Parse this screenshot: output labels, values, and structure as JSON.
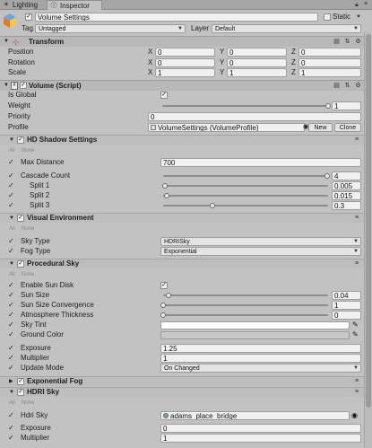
{
  "tabs": [
    {
      "label": "Lighting"
    },
    {
      "label": "Inspector"
    }
  ],
  "object": {
    "active": "✓",
    "name": "Volume Settings",
    "static_label": "Static",
    "tag_label": "Tag",
    "tag_value": "Untagged",
    "layer_label": "Layer",
    "layer_value": "Default"
  },
  "transform": {
    "title": "Transform",
    "position": {
      "label": "Position",
      "x": "0",
      "y": "0",
      "z": "0"
    },
    "rotation": {
      "label": "Rotation",
      "x": "0",
      "y": "0",
      "z": "0"
    },
    "scale": {
      "label": "Scale",
      "x": "1",
      "y": "1",
      "z": "1"
    }
  },
  "volume": {
    "title": "Volume (Script)",
    "is_global_label": "Is Global",
    "is_global": true,
    "weight_label": "Weight",
    "weight_value": "1",
    "weight_fraction": 1.0,
    "priority_label": "Priority",
    "priority_value": "0",
    "profile_label": "Profile",
    "profile_value": "VolumeSettings (VolumeProfile)",
    "new_label": "New",
    "clone_label": "Clone"
  },
  "hd_shadow": {
    "title": "HD Shadow Settings",
    "all": "All",
    "none": "None",
    "max_distance_label": "Max Distance",
    "max_distance": "700",
    "cascade_count_label": "Cascade Count",
    "cascade_count": "4",
    "cascade_count_fraction": 1.0,
    "split1_label": "Split 1",
    "split1": "0.005",
    "split1_fraction": 0.005,
    "split2_label": "Split 2",
    "split2": "0.015",
    "split2_fraction": 0.015,
    "split3_label": "Split 3",
    "split3": "0.3",
    "split3_fraction": 0.3
  },
  "visual_env": {
    "title": "Visual Environment",
    "all": "All",
    "none": "None",
    "sky_type_label": "Sky Type",
    "sky_type": "HDRISky",
    "fog_type_label": "Fog Type",
    "fog_type": "Exponential"
  },
  "procedural_sky": {
    "title": "Procedural Sky",
    "all": "All",
    "none": "None",
    "enable_sun_disk_label": "Enable Sun Disk",
    "enable_sun_disk": true,
    "sun_size_label": "Sun Size",
    "sun_size": "0.04",
    "sun_size_fraction": 0.04,
    "sun_size_conv_label": "Sun Size Convergence",
    "sun_size_conv": "1",
    "sun_size_conv_fraction": 0.0,
    "atmosphere_label": "Atmosphere Thickness",
    "atmosphere": "0",
    "atmosphere_fraction": 0.0,
    "sky_tint_label": "Sky Tint",
    "sky_tint_color": "#ffffff",
    "ground_color_label": "Ground Color",
    "ground_color": "#c8c8c8",
    "exposure_label": "Exposure",
    "exposure": "1.25",
    "multiplier_label": "Multiplier",
    "multiplier": "1",
    "update_mode_label": "Update Mode",
    "update_mode": "On Changed"
  },
  "exp_fog": {
    "title": "Exponential Fog"
  },
  "hdri_sky": {
    "title": "HDRI Sky",
    "all": "All",
    "none": "None",
    "hdri_sky_label": "Hdri Sky",
    "hdri_sky_value": "adams_place_bridge",
    "exposure_label": "Exposure",
    "exposure": "0",
    "multiplier_label": "Multiplier",
    "multiplier": "1"
  },
  "colors": {
    "panel": "#c2c2c2",
    "header": "#b8b8b8",
    "check": "#111111"
  },
  "icons": {
    "lighting": "light-bulb-icon",
    "inspector": "info-icon",
    "help": "help-book-icon",
    "settings": "gear-icon"
  }
}
